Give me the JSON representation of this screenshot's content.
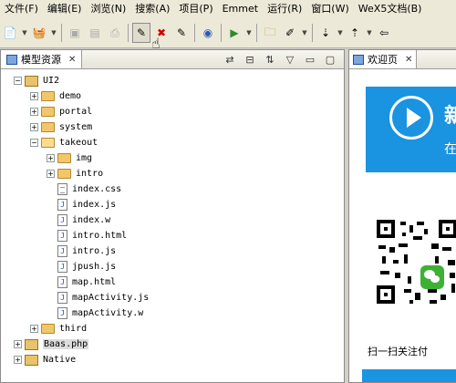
{
  "menubar": {
    "items": [
      "文件(F)",
      "编辑(E)",
      "浏览(N)",
      "搜索(A)",
      "项目(P)",
      "Emmet",
      "运行(R)",
      "窗口(W)",
      "WeX5文档(B)"
    ]
  },
  "toolbar": {
    "icons": [
      "new-icon",
      "new-dropdown-icon",
      "deploy-icon",
      "deploy-dropdown-icon",
      "save-icon",
      "save-all-icon",
      "print-icon",
      "tool-a-icon",
      "tool-b-icon",
      "tool-c-icon",
      "debug-icon",
      "run-icon",
      "run-dropdown-icon",
      "open-folder-icon",
      "brush-icon",
      "brush-dropdown-icon",
      "nav-a-icon",
      "nav-a-dropdown-icon",
      "nav-b-icon",
      "nav-b-dropdown-icon",
      "back-icon"
    ]
  },
  "left_panel": {
    "tab_label": "模型资源",
    "close": "✕"
  },
  "tree": [
    {
      "label": "UI2",
      "type": "project",
      "expanded": true,
      "level": 0
    },
    {
      "label": "demo",
      "type": "folder",
      "expanded": false,
      "level": 1
    },
    {
      "label": "portal",
      "type": "folder",
      "expanded": false,
      "level": 1
    },
    {
      "label": "system",
      "type": "folder",
      "expanded": false,
      "level": 1
    },
    {
      "label": "takeout",
      "type": "folder",
      "expanded": true,
      "level": 1
    },
    {
      "label": "img",
      "type": "folder",
      "expanded": false,
      "level": 2
    },
    {
      "label": "intro",
      "type": "folder",
      "expanded": false,
      "level": 2
    },
    {
      "label": "index.css",
      "type": "file-text",
      "level": 2
    },
    {
      "label": "index.js",
      "type": "file-js",
      "level": 2
    },
    {
      "label": "index.w",
      "type": "file-w",
      "level": 2
    },
    {
      "label": "intro.html",
      "type": "file-w",
      "level": 2
    },
    {
      "label": "intro.js",
      "type": "file-js",
      "level": 2
    },
    {
      "label": "jpush.js",
      "type": "file-js",
      "level": 2
    },
    {
      "label": "map.html",
      "type": "file-w",
      "level": 2
    },
    {
      "label": "mapActivity.js",
      "type": "file-js",
      "level": 2
    },
    {
      "label": "mapActivity.w",
      "type": "file-w",
      "level": 2
    },
    {
      "label": "third",
      "type": "folder",
      "expanded": false,
      "level": 1
    },
    {
      "label": "Baas.php",
      "type": "project",
      "expanded": false,
      "level": 0,
      "selected": true
    },
    {
      "label": "Native",
      "type": "project",
      "expanded": false,
      "level": 0
    }
  ],
  "right_panel": {
    "tab_label": "欢迎页",
    "close": "✕",
    "banner_text": "新",
    "banner_sub": "在",
    "scan_text": "扫一扫关注付"
  },
  "colors": {
    "accent": "#1a93e0",
    "wechat": "#3eb034"
  }
}
